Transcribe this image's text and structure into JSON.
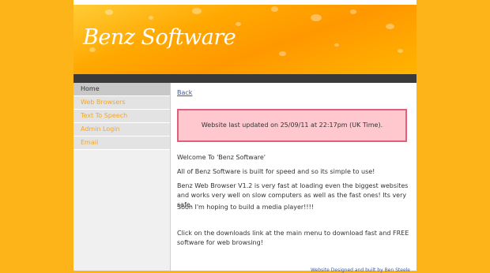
{
  "header": {
    "brand_title": "Benz Software"
  },
  "nav": {
    "items": [
      {
        "label": "Home",
        "active": true
      },
      {
        "label": "Web Browsers",
        "active": false
      },
      {
        "label": "Text To Speech",
        "active": false
      },
      {
        "label": "Admin Login",
        "active": false
      },
      {
        "label": "Email",
        "active": false
      }
    ]
  },
  "main": {
    "back_link": "Back",
    "notice": "Website last updated on 25/09/11 at 22:17pm (UK Time).",
    "paragraphs": [
      "Welcome To 'Benz Software'",
      "All of Benz Software is built for speed and so its simple to use!",
      "Benz Web Browser V1.2 is very fast at loading even the biggest websites and works very well on slow computers as well as the fast ones! Its very safe.",
      "Soon I'm hoping to build a media player!!!!",
      "Click on the downloads link at the main menu to download fast and FREE software for web browsing!"
    ],
    "footer_credit": "Website Designed and built by Ben Steele"
  },
  "colors": {
    "page_background": "#fdb418",
    "nav_link": "#f5a623",
    "notice_background": "#ffc8cf",
    "notice_border": "#e0607a",
    "link": "#3b57a8"
  }
}
